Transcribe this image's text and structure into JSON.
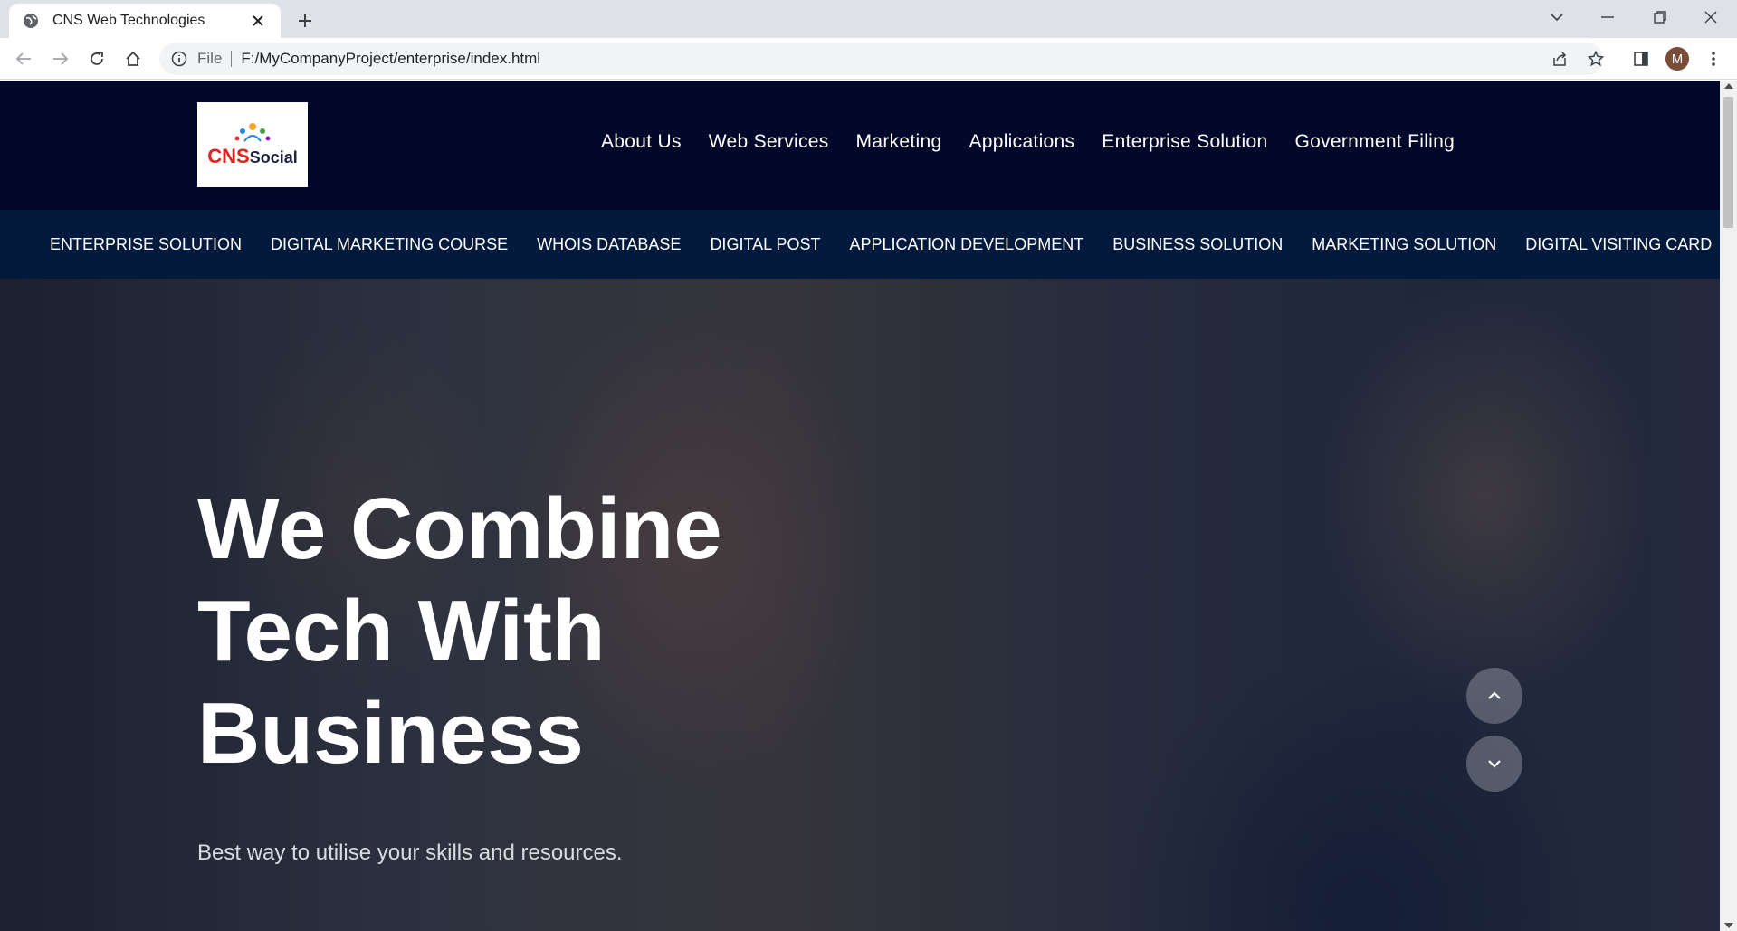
{
  "browser": {
    "tab_title": "CNS Web Technologies",
    "url_scheme": "File",
    "url": "F:/MyCompanyProject/enterprise/index.html",
    "profile_initial": "M"
  },
  "site": {
    "logo": {
      "primary": "CNS",
      "secondary": "Social"
    },
    "main_menu": [
      "About Us",
      "Web Services",
      "Marketing",
      "Applications",
      "Enterprise Solution",
      "Government Filing"
    ],
    "sub_menu": [
      "ENTERPRISE SOLUTION",
      "DIGITAL MARKETING COURSE",
      "WHOIS DATABASE",
      "DIGITAL POST",
      "APPLICATION DEVELOPMENT",
      "BUSINESS SOLUTION",
      "MARKETING SOLUTION",
      "DIGITAL VISITING CARD"
    ],
    "hero": {
      "headline_line1": "We Combine",
      "headline_line2": "Tech With",
      "headline_line3": "Business",
      "tagline": "Best way to utilise your skills and resources."
    }
  },
  "colors": {
    "topnav_bg": "#020829",
    "subnav_bg": "#031a3c",
    "accent": "#f5a623"
  }
}
